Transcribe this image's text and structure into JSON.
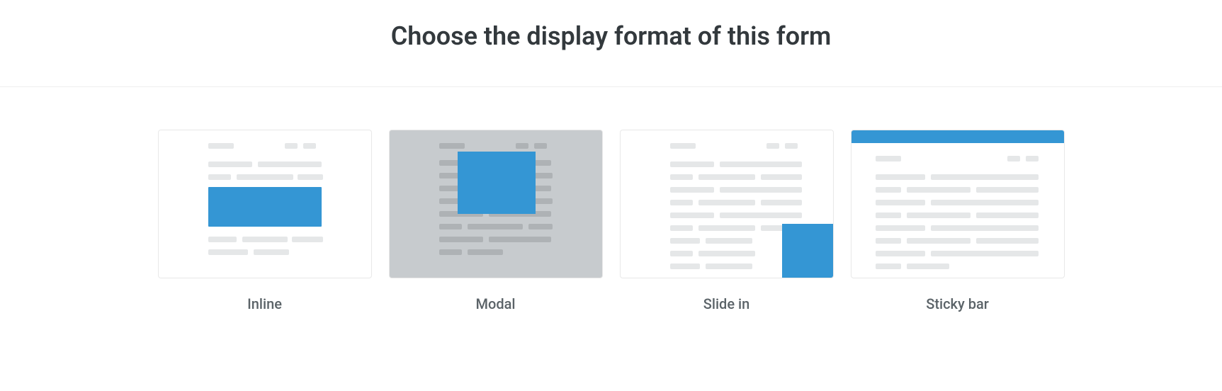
{
  "title": "Choose the display format of this form",
  "options": [
    {
      "id": "inline",
      "label": "Inline"
    },
    {
      "id": "modal",
      "label": "Modal"
    },
    {
      "id": "slidein",
      "label": "Slide in"
    },
    {
      "id": "stickybar",
      "label": "Sticky bar"
    }
  ],
  "colors": {
    "accent": "#3496d4",
    "placeholder": "#e5e7e8",
    "modalBg": "#c7cbce",
    "modalPlaceholder": "#aeb2b5",
    "border": "#e8e8e8",
    "text": "#33393d",
    "labelText": "#5b6368"
  }
}
